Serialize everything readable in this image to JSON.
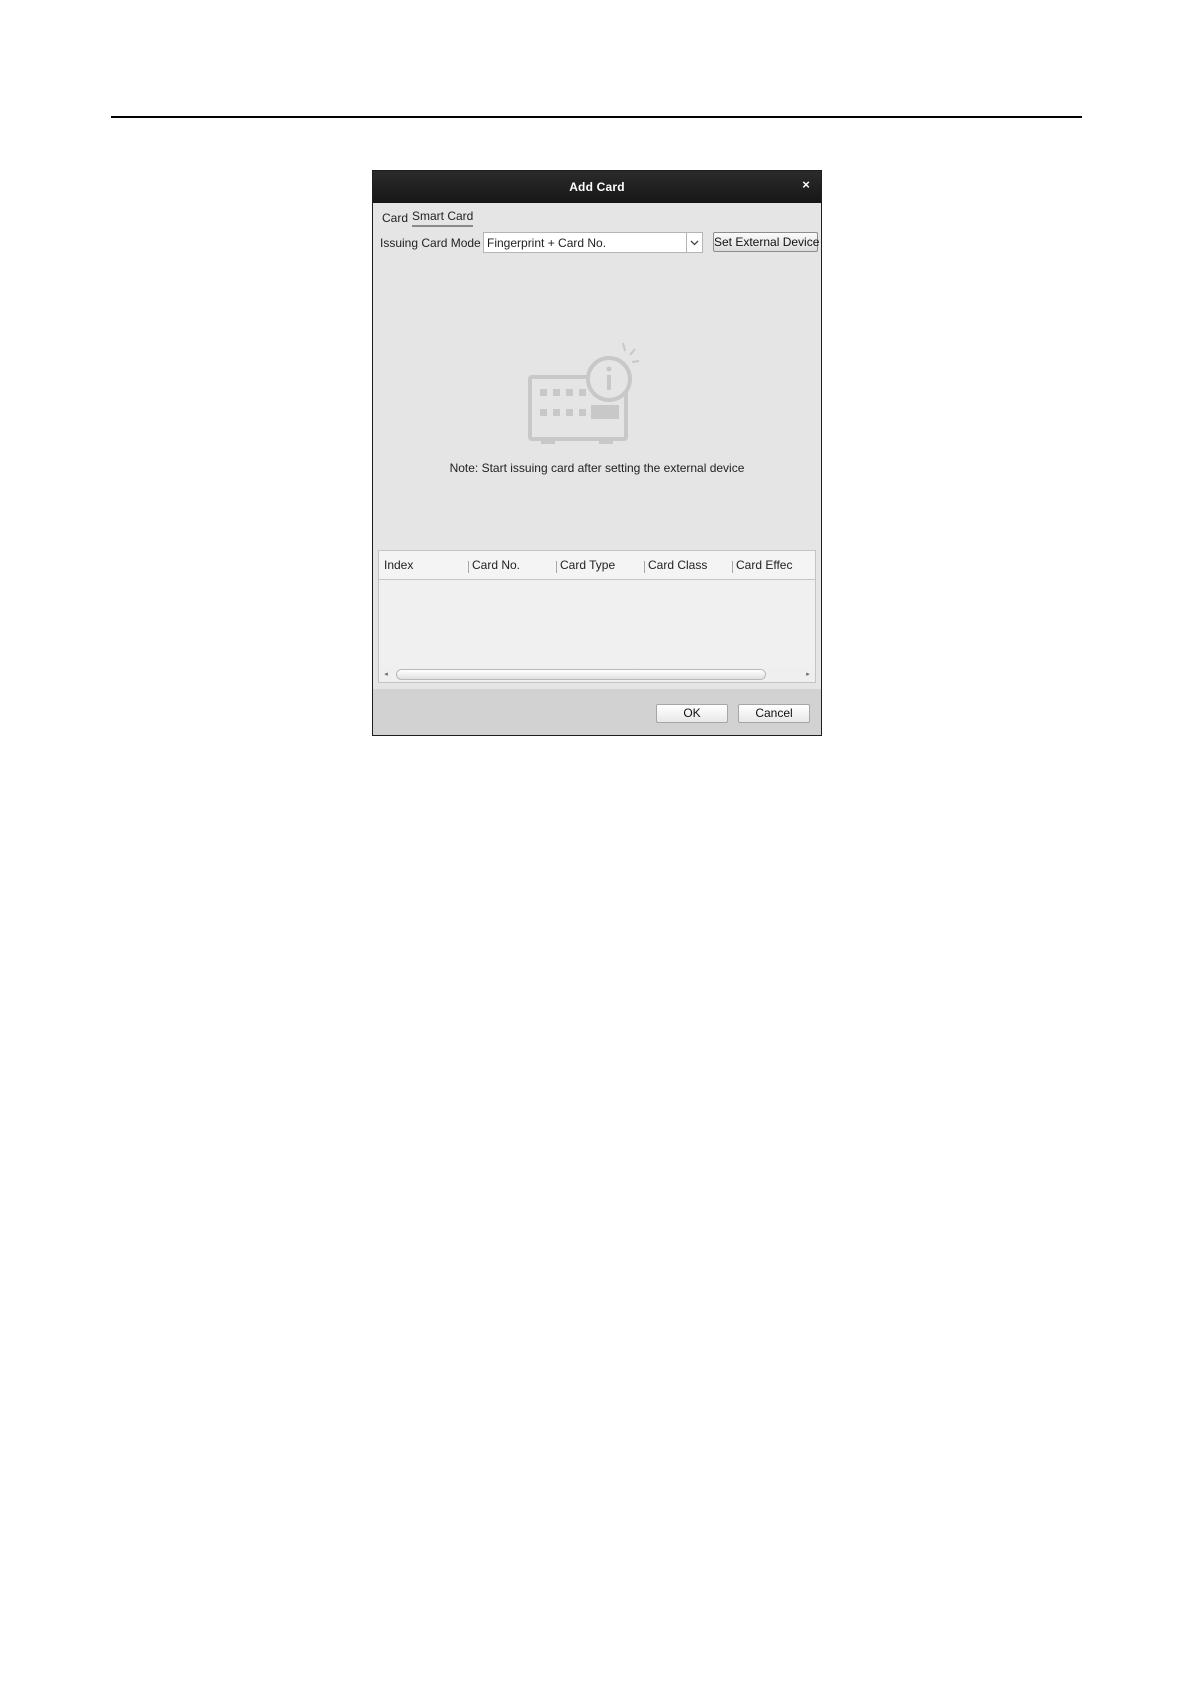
{
  "dialog": {
    "title": "Add Card",
    "close_symbol": "×",
    "close_icon": "close-icon"
  },
  "tabs": [
    {
      "label": "Card",
      "active": false
    },
    {
      "label": "Smart Card",
      "active": true
    }
  ],
  "issuing": {
    "label": "Issuing Card Mode",
    "selected": "Fingerprint + Card No.",
    "dropdown_icon": "chevron-down-icon",
    "external_button": "Set External Device"
  },
  "illustration": {
    "icon": "card-reader-info-icon"
  },
  "note": "Note: Start issuing card after setting the external device",
  "table": {
    "columns": [
      "Index",
      "Card No.",
      "Card Type",
      "Card Class",
      "Card Effec"
    ],
    "rows": []
  },
  "scrollbar": {
    "left_symbol": "◂",
    "right_symbol": "▸"
  },
  "footer": {
    "ok": "OK",
    "cancel": "Cancel"
  },
  "colors": {
    "titlebar": "#1e1e1e",
    "dialog_body": "#e5e5e5",
    "footer": "#d2d2d2",
    "illustration": "#c8c8c8"
  }
}
